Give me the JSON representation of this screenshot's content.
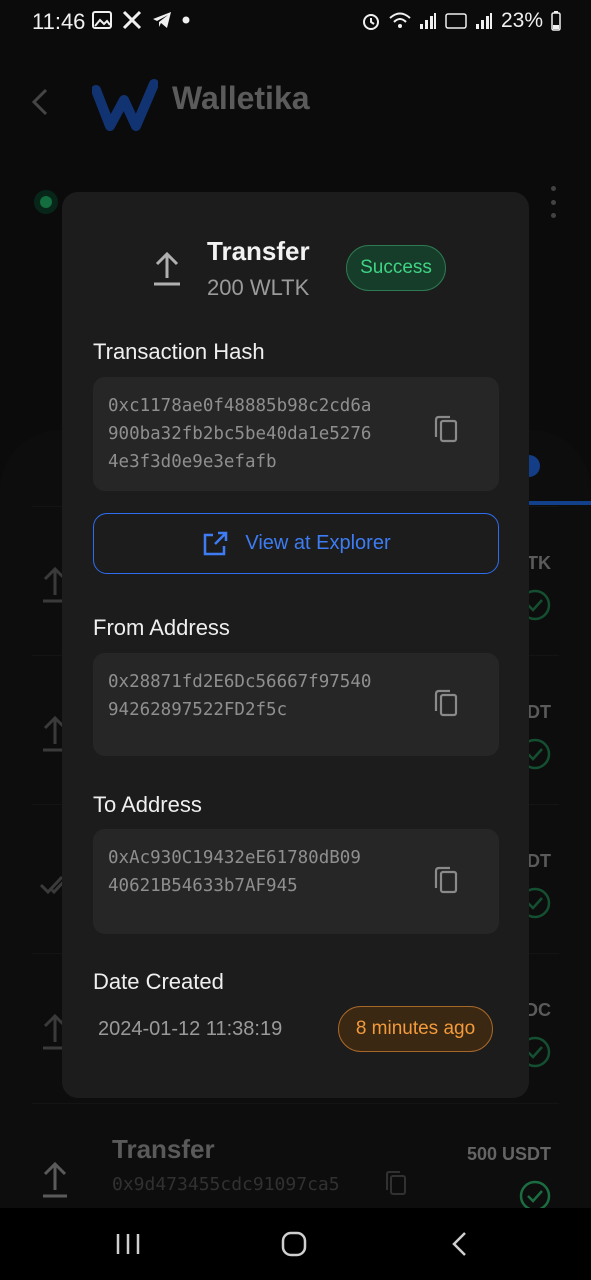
{
  "status_bar": {
    "time": "11:46",
    "battery": "23%"
  },
  "header": {
    "brand": "Walletika"
  },
  "background_list": {
    "amounts": [
      "TK",
      "DT",
      "DT",
      "DC"
    ],
    "last_row": {
      "title": "Transfer",
      "hash": "0x9d473455cdc91097ca5",
      "amount": "500 USDT"
    }
  },
  "modal": {
    "title": "Transfer",
    "amount": "200 WLTK",
    "status_badge": "Success",
    "tx_hash_label": "Transaction Hash",
    "tx_hash_lines": [
      "0xc1178ae0f48885b98c2cd6a",
      "900ba32fb2bc5be40da1e5276",
      "4e3f3d0e9e3efafb"
    ],
    "explorer_button": "View at Explorer",
    "from_label": "From Address",
    "from_lines": [
      "0x28871fd2E6Dc56667f97540",
      "94262897522FD2f5c"
    ],
    "to_label": "To Address",
    "to_lines": [
      "0xAc930C19432eE61780dB09",
      "40621B54633b7AF945"
    ],
    "date_label": "Date Created",
    "date_value": "2024-01-12 11:38:19",
    "date_ago": "8 minutes ago"
  },
  "colors": {
    "success": "#3fd484",
    "accent": "#2d6ef0",
    "warning": "#f29a3c"
  }
}
